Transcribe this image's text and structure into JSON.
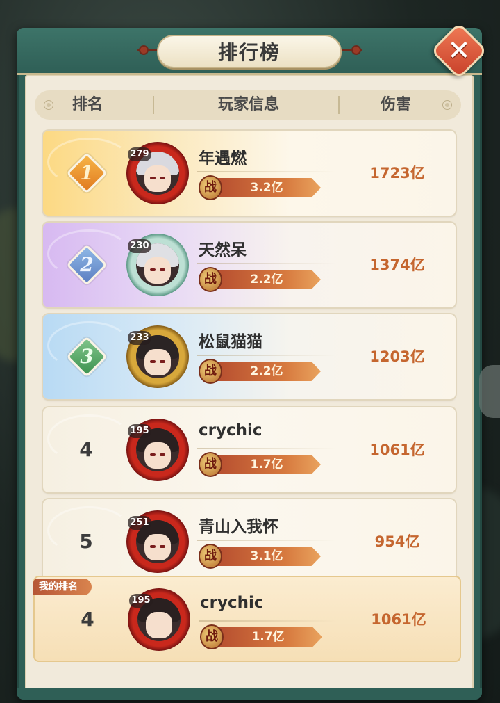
{
  "title": "排行榜",
  "close_icon": "close-icon",
  "header": {
    "rank": "排名",
    "player_info": "玩家信息",
    "damage": "伤害"
  },
  "power_icon_glyph": "战",
  "rows": [
    {
      "rank": "1",
      "level": "279",
      "name": "年遇燃",
      "power": "3.2亿",
      "damage": "1723亿",
      "tier": "gold"
    },
    {
      "rank": "2",
      "level": "230",
      "name": "天然呆",
      "power": "2.2亿",
      "damage": "1374亿",
      "tier": "purple"
    },
    {
      "rank": "3",
      "level": "233",
      "name": "松鼠猫猫",
      "power": "2.2亿",
      "damage": "1203亿",
      "tier": "blue"
    },
    {
      "rank": "4",
      "level": "195",
      "name": "crychic",
      "power": "1.7亿",
      "damage": "1061亿",
      "tier": "plain"
    },
    {
      "rank": "5",
      "level": "251",
      "name": "青山入我怀",
      "power": "3.1亿",
      "damage": "954亿",
      "tier": "plain"
    }
  ],
  "my_rank": {
    "tag": "我的排名",
    "rank": "4",
    "level": "195",
    "name": "crychic",
    "power": "1.7亿",
    "damage": "1061亿"
  },
  "colors": {
    "frame": "#2f5f56",
    "gold_row": "#fbe7b4",
    "purple_row": "#e6d6f3",
    "blue_row": "#d5e7f5",
    "damage_text": "#c5662f",
    "close_button": "#e05a3c"
  }
}
